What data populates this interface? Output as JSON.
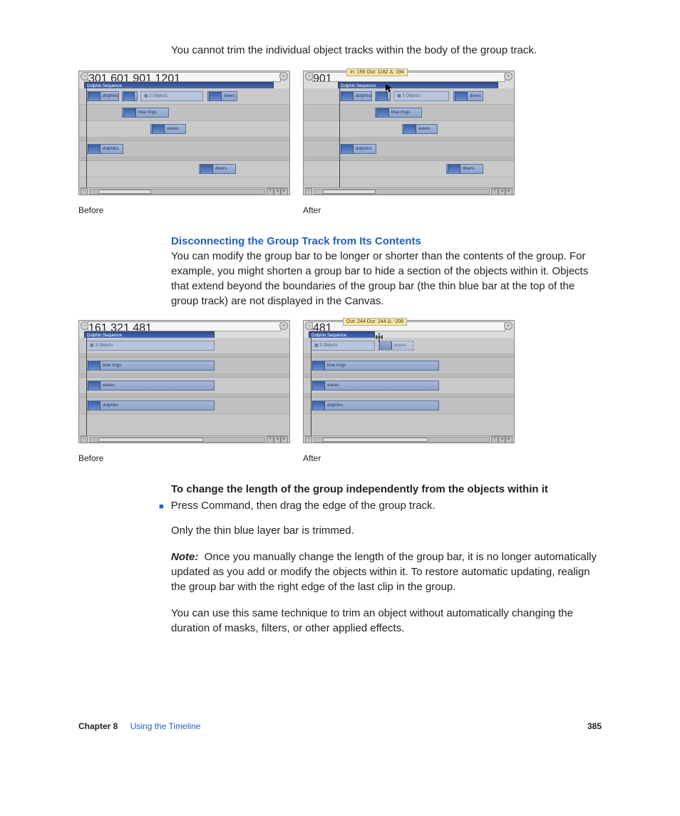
{
  "intro": "You cannot trim the individual object tracks within the body of the group track.",
  "fig1": {
    "beforeLabel": "Before",
    "afterLabel": "After",
    "ruler": [
      "301",
      "601",
      "901",
      "1201"
    ],
    "tooltip": "In: 195 Out: 1182 Δ: 194",
    "groupName": "Dolphin Sequence",
    "summary": "2 Objects",
    "clips": {
      "dolphins": "dolphins",
      "divers": "divers",
      "bluerings": "blue rings",
      "waves": "waves"
    }
  },
  "sectionTitle": "Disconnecting the Group Track from Its Contents",
  "sectionBody": "You can modify the group bar to be longer or shorter than the contents of the group. For example, you might shorten a group bar to hide a section of the objects within it. Objects that extend beyond the boundaries of the group bar (the thin blue bar at the top of the group track) are not displayed in the Canvas.",
  "fig2": {
    "beforeLabel": "Before",
    "afterLabel": "After",
    "ruler": [
      "161",
      "321",
      "481"
    ],
    "tooltip": "Out: 244 Dur: 244 Δ: -206",
    "groupName": "Dolphin Sequence",
    "summary": "3 Objects",
    "clips": {
      "bluerings": "blue rings",
      "waves": "waves",
      "dolphins": "dolphins"
    }
  },
  "instrTitle": "To change the length of the group independently from the objects within it",
  "bullet": "Press Command, then drag the edge of the group track.",
  "afterBullet": "Only the thin blue layer bar is trimmed.",
  "noteLabel": "Note:",
  "noteBody": "Once you manually change the length of the group bar, it is no longer automatically updated as you add or modify the objects within it. To restore automatic updating, realign the group bar with the right edge of the last clip in the group.",
  "closing": "You can use this same technique to trim an object without automatically changing the duration of masks, filters, or other applied effects.",
  "footer": {
    "chapterLabel": "Chapter 8",
    "chapterTitle": "Using the Timeline",
    "page": "385"
  }
}
